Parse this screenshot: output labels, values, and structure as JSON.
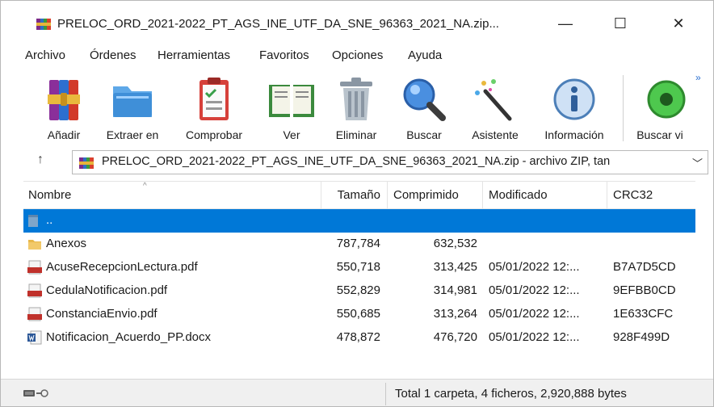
{
  "window": {
    "title": "PRELOC_ORD_2021-2022_PT_AGS_INE_UTF_DA_SNE_96363_2021_NA.zip...",
    "minimize": "—",
    "maximize": "☐",
    "close": "✕"
  },
  "menu": [
    "Archivo",
    "Órdenes",
    "Herramientas",
    "Favoritos",
    "Opciones",
    "Ayuda"
  ],
  "toolbar": {
    "buttons": [
      {
        "label": "Añadir",
        "icon": "winrar-books-icon"
      },
      {
        "label": "Extraer en",
        "icon": "folder-icon"
      },
      {
        "label": "Comprobar",
        "icon": "clipboard-check-icon"
      },
      {
        "label": "Ver",
        "icon": "open-book-icon"
      },
      {
        "label": "Eliminar",
        "icon": "trash-bin-icon"
      },
      {
        "label": "Buscar",
        "icon": "magnifier-icon"
      },
      {
        "label": "Asistente",
        "icon": "magic-wand-icon"
      },
      {
        "label": "Información",
        "icon": "info-icon"
      },
      {
        "label": "Buscar vi",
        "icon": "virus-scan-icon"
      }
    ],
    "more": "»"
  },
  "address": {
    "up": "↑",
    "path": "PRELOC_ORD_2021-2022_PT_AGS_INE_UTF_DA_SNE_96363_2021_NA.zip - archivo ZIP, tan",
    "dropdown": "﹀"
  },
  "columns": [
    "Nombre",
    "Tamaño",
    "Comprimido",
    "Modificado",
    "CRC32"
  ],
  "rows": [
    {
      "name": "..",
      "size": "",
      "packed": "",
      "modified": "",
      "crc": "",
      "icon": "parent-folder-icon",
      "selected": true
    },
    {
      "name": "Anexos",
      "size": "787,784",
      "packed": "632,532",
      "modified": "",
      "crc": "",
      "icon": "folder-icon"
    },
    {
      "name": "AcuseRecepcionLectura.pdf",
      "size": "550,718",
      "packed": "313,425",
      "modified": "05/01/2022 12:...",
      "crc": "B7A7D5CD",
      "icon": "pdf-icon"
    },
    {
      "name": "CedulaNotificacion.pdf",
      "size": "552,829",
      "packed": "314,981",
      "modified": "05/01/2022 12:...",
      "crc": "9EFBB0CD",
      "icon": "pdf-icon"
    },
    {
      "name": "ConstanciaEnvio.pdf",
      "size": "550,685",
      "packed": "313,264",
      "modified": "05/01/2022 12:...",
      "crc": "1E633CFC",
      "icon": "pdf-icon"
    },
    {
      "name": "Notificacion_Acuerdo_PP.docx",
      "size": "478,872",
      "packed": "476,720",
      "modified": "05/01/2022 12:...",
      "crc": "928F499D",
      "icon": "word-doc-icon"
    }
  ],
  "status": {
    "text": "Total 1 carpeta, 4 ficheros, 2,920,888 bytes"
  },
  "colors": {
    "selection": "#0078d7",
    "folder": "#e8b84a",
    "pdf": "#c0312b",
    "word": "#2b5797"
  }
}
